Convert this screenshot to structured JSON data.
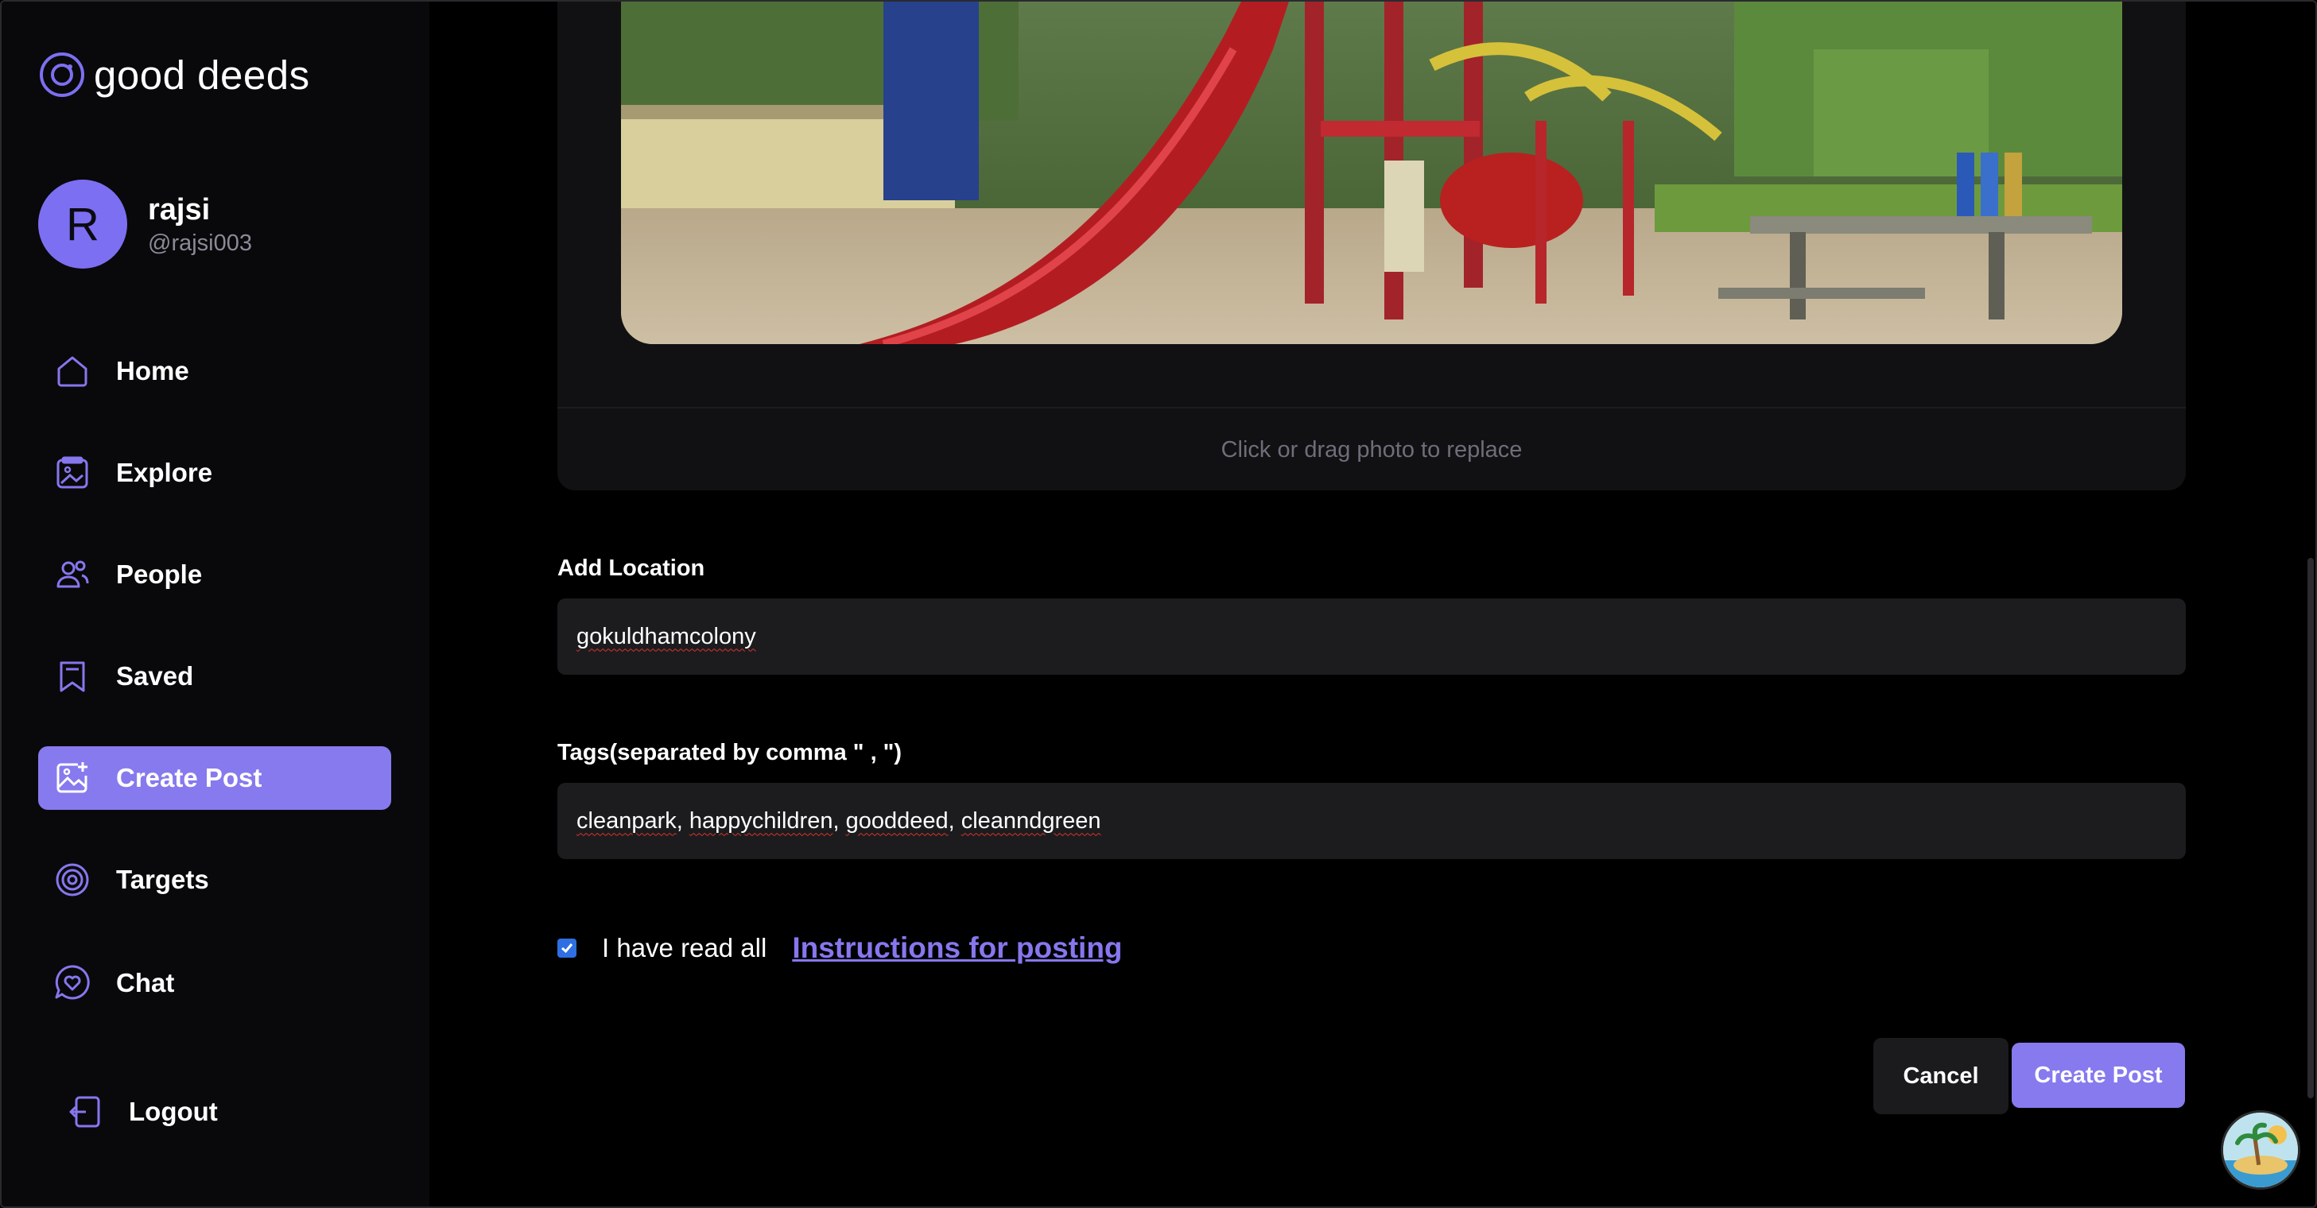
{
  "app": {
    "name": "good deeds"
  },
  "profile": {
    "initial": "R",
    "name": "rajsi",
    "handle": "@rajsi003"
  },
  "nav": {
    "home": "Home",
    "explore": "Explore",
    "people": "People",
    "saved": "Saved",
    "create_post": "Create Post",
    "targets": "Targets",
    "chat": "Chat",
    "logout": "Logout"
  },
  "upload": {
    "hint": "Click or drag photo to replace"
  },
  "location": {
    "label": "Add Location",
    "value": "gokuldhamcolony"
  },
  "tags": {
    "label": "Tags(separated by comma \" , \")",
    "values": [
      "cleanpark",
      "happychildren",
      "gooddeed",
      "cleanndgreen"
    ]
  },
  "agreement": {
    "checked": true,
    "text": "I have read all",
    "link": "Instructions for posting"
  },
  "actions": {
    "cancel": "Cancel",
    "submit": "Create Post"
  },
  "colors": {
    "accent": "#877aee",
    "sidebar_bg": "#09090b",
    "input_bg": "#1c1c1f",
    "checkbox": "#2f6fe4"
  },
  "icons": [
    "logo-icon",
    "home-icon",
    "explore-icon",
    "people-icon",
    "bookmark-icon",
    "image-plus-icon",
    "target-icon",
    "chat-heart-icon",
    "logout-icon",
    "island-icon"
  ]
}
